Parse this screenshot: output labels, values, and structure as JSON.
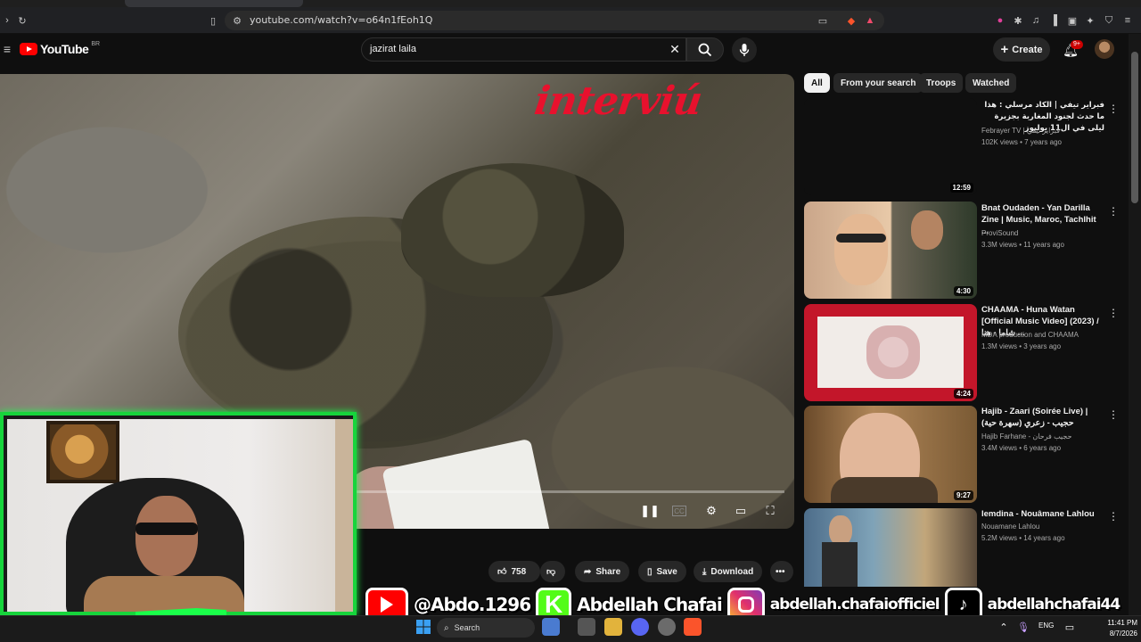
{
  "browser": {
    "url": "youtube.com/watch?v=o64n1fEoh1Q"
  },
  "header": {
    "logo_text": "YouTube",
    "region": "BR",
    "search_value": "jazirat laila",
    "create_label": "Create",
    "notifications_badge": "9+"
  },
  "player": {
    "overlay_brand": "interviú"
  },
  "chips": [
    {
      "label": "All",
      "active": true
    },
    {
      "label": "From your search",
      "active": false
    },
    {
      "label": "Troops",
      "active": false
    },
    {
      "label": "Watched",
      "active": false
    }
  ],
  "recommendations": [
    {
      "title": "فبراير تيفي | الكاد مرسلي : هذا ما حدث لجنود المغاربة بجزيرة ليلى في ال11 يوليوز",
      "channel": "Febrayer TV | فبراير تيفي",
      "meta": "102K views • 7 years ago",
      "duration": "12:59"
    },
    {
      "title": "Bnat Oudaden - Yan Darilla Zine | Music, Maroc, Tachlhit ...",
      "channel": "ProviSound",
      "meta": "3.3M views • 11 years ago",
      "duration": "4:30"
    },
    {
      "title": "CHAAMA - Huna Watan [Official Music Video] (2023) / شاما - هنا ...",
      "channel": "MDA production and CHAAMA",
      "meta": "1.3M views • 3 years ago",
      "duration": "4:24"
    },
    {
      "title": "Hajib - Zaari (Soirée Live) | حجيب - زعري (سهرة حية)",
      "channel": "Hajib Farhane - حجيب فرحان",
      "meta": "3.4M views • 6 years ago",
      "duration": "9:27"
    },
    {
      "title": "lemdina - Nouâmane Lahlou",
      "channel": "Nouamane Lahlou",
      "meta": "5.2M views • 14 years ago",
      "duration": ""
    }
  ],
  "actions": {
    "likes": "758",
    "share": "Share",
    "save": "Save",
    "download": "Download"
  },
  "social": {
    "youtube": "@Abdo.1296",
    "kick": "Abdellah Chafai",
    "instagram": "abdellah.chafaiofficiel",
    "tiktok": "abdellahchafai44"
  },
  "taskbar": {
    "search_label": "Search",
    "lang": "ENG",
    "time": "11:41 PM",
    "date": "8/7/2026"
  },
  "colors": {
    "accent_red": "#ff0000",
    "cam_border": "#17d43c"
  }
}
